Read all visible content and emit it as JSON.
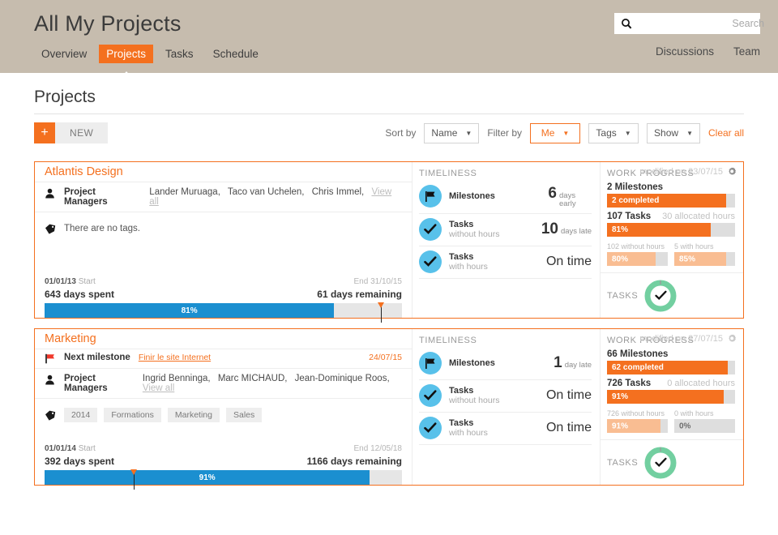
{
  "header": {
    "title": "All My Projects",
    "nav": [
      {
        "label": "Overview",
        "active": false
      },
      {
        "label": "Projects",
        "active": true
      },
      {
        "label": "Tasks",
        "active": false
      },
      {
        "label": "Schedule",
        "active": false
      }
    ],
    "search": {
      "placeholder": "Search",
      "value": "",
      "icon": "search-icon"
    },
    "links": [
      "Discussions",
      "Team"
    ],
    "bg_color": "#c6bcae",
    "accent_color": "#f4701f"
  },
  "page": {
    "title": "Projects",
    "new_button": {
      "plus": "+",
      "label": "NEW"
    },
    "sort": {
      "label": "Sort by",
      "value": "Name"
    },
    "filter": {
      "label": "Filter by",
      "me": "Me",
      "tags": "Tags",
      "show": "Show",
      "clear": "Clear all"
    },
    "view_toggles": [
      {
        "name": "list-view-icon",
        "active": false
      },
      {
        "name": "chart-view-icon",
        "active": true
      },
      {
        "name": "grid-view-icon",
        "active": false
      }
    ]
  },
  "labels": {
    "timeliness": "TIMELINESS",
    "work_progress": "WORK PROGRESS",
    "tasks": "TASKS",
    "project_managers": "Project Managers",
    "view_all": "View all",
    "next_milestone": "Next milestone",
    "start_label": "Start",
    "milestones": "Milestones",
    "tasks_without_hours": "Tasks",
    "tasks_without_hours_sub": "without hours",
    "tasks_with_hours": "Tasks",
    "tasks_with_hours_sub": "with hours"
  },
  "projects": [
    {
      "name": "Atlantis Design",
      "modified": "modified on 23/07/15",
      "managers": [
        "Lander Muruaga,",
        "Taco van Uchelen,",
        "Chris Immel,"
      ],
      "tags": [],
      "no_tags_text": "There are no tags.",
      "next_milestone": null,
      "timeliness": [
        {
          "icon": "flag-icon",
          "title": "Milestones",
          "sub": "",
          "value": "6",
          "unit": "days early"
        },
        {
          "icon": "check-icon",
          "title": "Tasks",
          "sub": "without hours",
          "value": "10",
          "unit": "days late"
        },
        {
          "icon": "check-icon",
          "title": "Tasks",
          "sub": "with hours",
          "value": "",
          "unit": "",
          "status": "On time"
        }
      ],
      "work_progress": {
        "milestones_count": "2 Milestones",
        "milestones_completed": "2 completed",
        "milestones_pct": 93,
        "tasks_count": "107 Tasks",
        "allocated_hours": "30 allocated hours",
        "tasks_pct_label": "81%",
        "tasks_pct": 81,
        "sub": [
          {
            "label": "102 without hours",
            "pct_label": "80%",
            "pct": 80
          },
          {
            "label": "5 with hours",
            "pct_label": "85%",
            "pct": 85
          }
        ]
      },
      "timeline": {
        "start_date": "01/01/13",
        "end_date": "End 31/10/15",
        "days_spent": "643 days spent",
        "days_remaining": "61 days remaining",
        "pct_label": "81%",
        "pct": 81,
        "marker_pct": 94
      }
    },
    {
      "name": "Marketing",
      "modified": "modified on 27/07/15",
      "managers": [
        "Ingrid Benninga,",
        "Marc MICHAUD,",
        "Jean-Dominique Roos,"
      ],
      "tags": [
        "2014",
        "Formations",
        "Marketing",
        "Sales"
      ],
      "no_tags_text": "",
      "next_milestone": {
        "title": "Next milestone",
        "link": "Finir le site Internet",
        "date": "24/07/15"
      },
      "timeliness": [
        {
          "icon": "flag-icon",
          "title": "Milestones",
          "sub": "",
          "value": "1",
          "unit": "day late"
        },
        {
          "icon": "check-icon",
          "title": "Tasks",
          "sub": "without hours",
          "value": "",
          "unit": "",
          "status": "On time"
        },
        {
          "icon": "check-icon",
          "title": "Tasks",
          "sub": "with hours",
          "value": "",
          "unit": "",
          "status": "On time"
        }
      ],
      "work_progress": {
        "milestones_count": "66 Milestones",
        "milestones_completed": "62 completed",
        "milestones_pct": 94,
        "tasks_count": "726 Tasks",
        "allocated_hours": "0 allocated hours",
        "tasks_pct_label": "91%",
        "tasks_pct": 91,
        "sub": [
          {
            "label": "726 without hours",
            "pct_label": "91%",
            "pct": 88
          },
          {
            "label": "0 with hours",
            "pct_label": "0%",
            "pct": 0
          }
        ]
      },
      "timeline": {
        "start_date": "01/01/14",
        "end_date": "End 12/05/18",
        "days_spent": "392 days spent",
        "days_remaining": "1166 days remaining",
        "pct_label": "91%",
        "pct": 91,
        "marker_pct": 25
      }
    }
  ],
  "colors": {
    "orange": "#f4701f",
    "blue": "#1b8fd0",
    "light_blue_circle": "#58c1ea",
    "green": "#72cfa0",
    "peach": "#f9bd92",
    "track_grey": "#dedede"
  }
}
